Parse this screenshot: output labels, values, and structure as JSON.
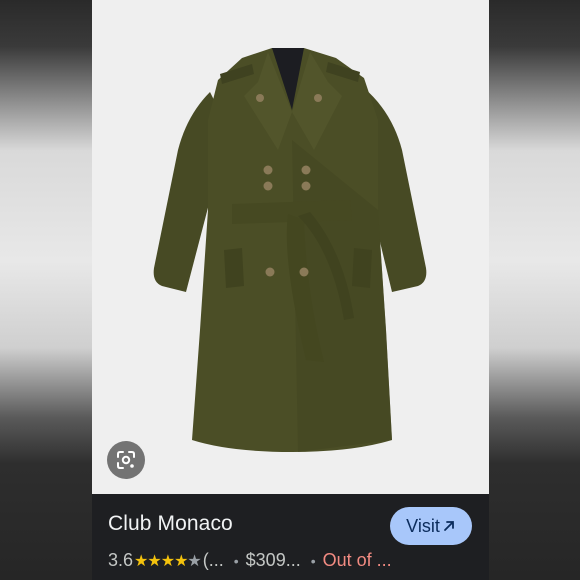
{
  "result": {
    "title": "Club Monaco",
    "visit_label": "Visit",
    "rating": "3.6",
    "stars": [
      "full",
      "full",
      "full",
      "half",
      "empty"
    ],
    "review_count": "(...",
    "price": "$309...",
    "stock": "Out of ...",
    "stock_color": "#f28b82",
    "accent": "#a8c7fa"
  },
  "icons": {
    "lens": "google-lens-icon",
    "visit_arrow": "arrow-icon"
  }
}
